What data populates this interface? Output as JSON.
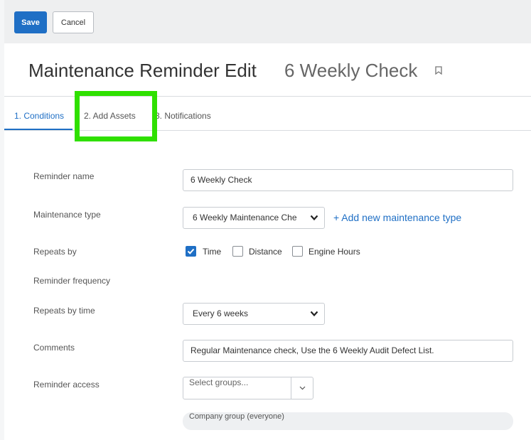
{
  "toolbar": {
    "save_label": "Save",
    "cancel_label": "Cancel"
  },
  "header": {
    "title": "Maintenance Reminder Edit",
    "subtitle": "6 Weekly Check",
    "bookmark_icon": "bookmark-icon"
  },
  "tabs": [
    {
      "label": "1. Conditions",
      "active": true
    },
    {
      "label": "2. Add Assets",
      "active": false
    },
    {
      "label": "3. Notifications",
      "active": false
    }
  ],
  "form": {
    "reminder_name": {
      "label": "Reminder name",
      "value": "6 Weekly Check"
    },
    "maintenance_type": {
      "label": "Maintenance type",
      "value": "6 Weekly Maintenance Che",
      "add_link": "+ Add new maintenance type"
    },
    "repeats_by": {
      "label": "Repeats by",
      "options": [
        {
          "label": "Time",
          "checked": true
        },
        {
          "label": "Distance",
          "checked": false
        },
        {
          "label": "Engine Hours",
          "checked": false
        }
      ]
    },
    "reminder_frequency": {
      "label": "Reminder frequency"
    },
    "repeats_by_time": {
      "label": "Repeats by time",
      "value": "Every 6 weeks"
    },
    "comments": {
      "label": "Comments",
      "value": "Regular Maintenance check, Use the  6 Weekly Audit Defect List."
    },
    "reminder_access": {
      "label": "Reminder access",
      "placeholder": "Select groups...",
      "chip": "Company group (everyone)"
    }
  },
  "colors": {
    "accent": "#1f6fc5",
    "highlight": "#2fe000"
  }
}
